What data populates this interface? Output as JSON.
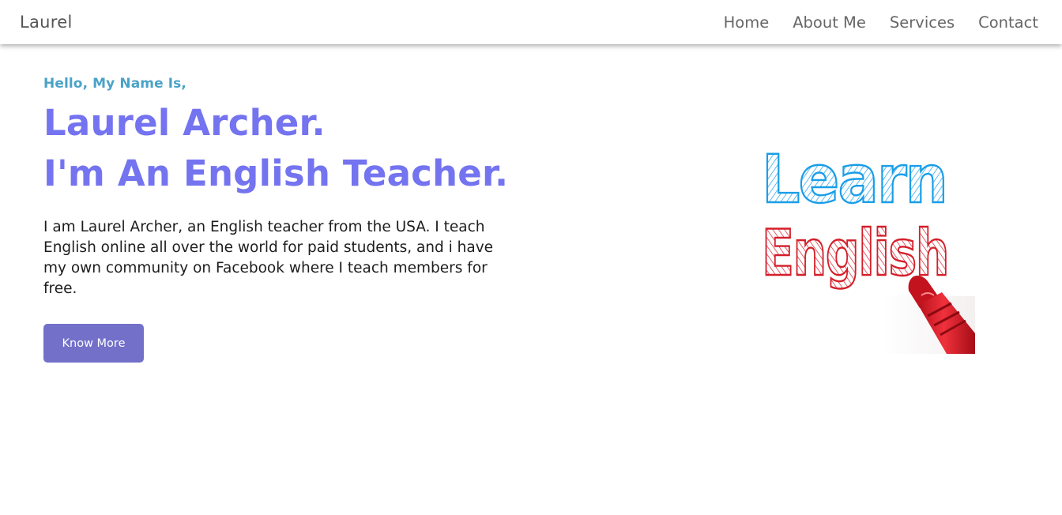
{
  "nav": {
    "brand": "Laurel",
    "links": [
      {
        "label": "Home"
      },
      {
        "label": "About Me"
      },
      {
        "label": "Services"
      },
      {
        "label": "Contact"
      }
    ]
  },
  "hero": {
    "greeting": "Hello, My Name Is,",
    "name_line": "Laurel Archer.",
    "role_line": "I'm An English Teacher.",
    "bio": "I am Laurel Archer, an English teacher from the USA. I teach English online all over the world for paid students, and i have my own community on Facebook where I teach members for free.",
    "cta_label": "Know More"
  },
  "illustration": {
    "word1": "Learn",
    "word2": "English"
  },
  "colors": {
    "accent": "#7473f0",
    "greeting": "#4aa3c8",
    "button": "#7270c9",
    "learn_blue": "#1a9ee8",
    "english_red": "#d41f2a"
  }
}
